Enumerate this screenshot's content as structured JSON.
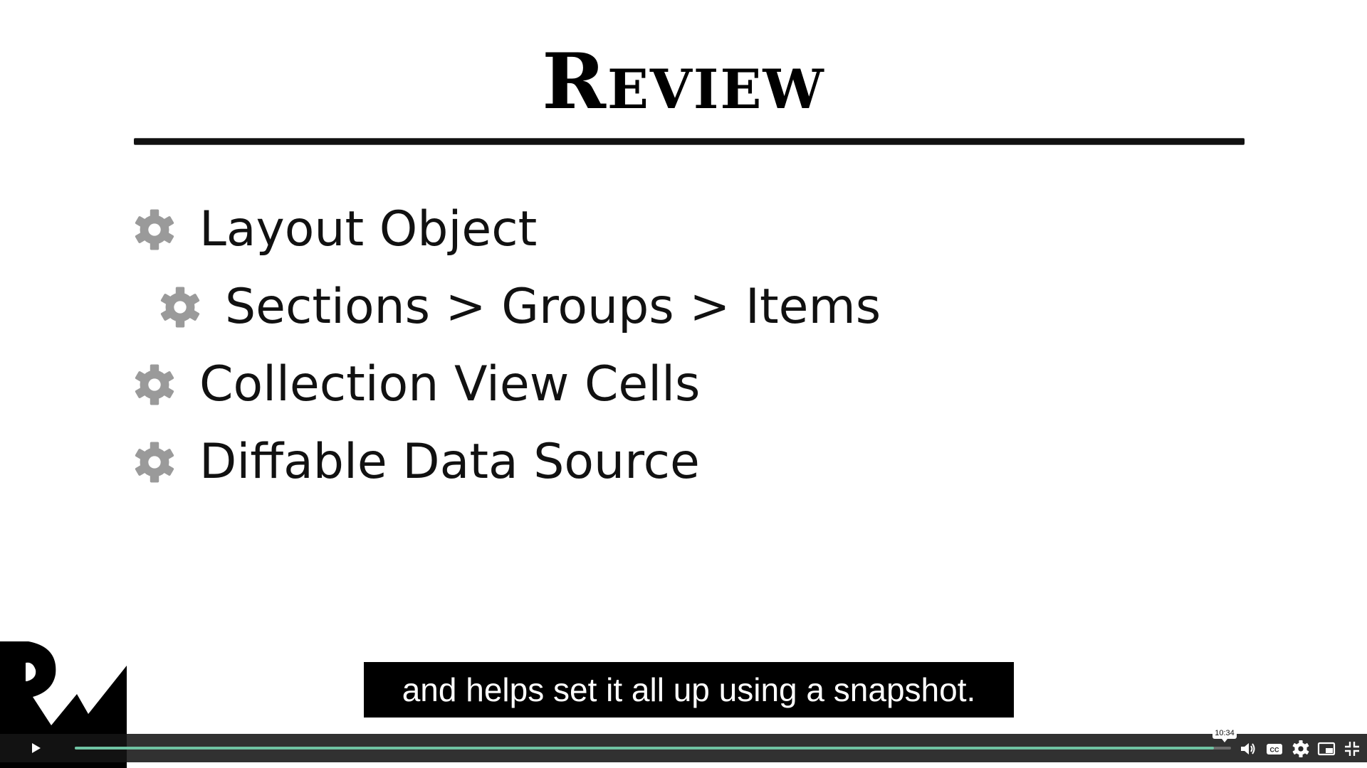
{
  "slide": {
    "title": "Review",
    "bullets": [
      {
        "text": "Layout Object",
        "level": 1
      },
      {
        "text": "Sections > Groups > Items",
        "level": 2
      },
      {
        "text": "Collection View Cells",
        "level": 1
      },
      {
        "text": "Diffable Data Source",
        "level": 1
      }
    ],
    "bullet_icon": "gear-icon",
    "bullet_icon_color": "#9a9a9a"
  },
  "player": {
    "caption": "and helps set it all up using a snapshot.",
    "time_tooltip": "10:34",
    "progress_fraction": 0.985,
    "accent_color": "#6fc3a3",
    "icons": [
      "play-icon",
      "volume-icon",
      "closed-captions-icon",
      "settings-gear-icon",
      "picture-in-picture-icon",
      "exit-fullscreen-icon"
    ]
  }
}
